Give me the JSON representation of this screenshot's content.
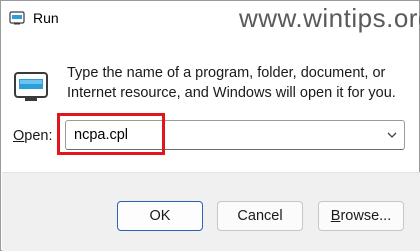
{
  "window": {
    "title": "Run",
    "icon": "run-icon"
  },
  "watermark": "www.wintips.org",
  "description": {
    "line1": "Type the name of a program, folder, document, or",
    "line2": "Internet resource, and Windows will open it for you."
  },
  "open": {
    "label_accel": "O",
    "label_rest": "pen:",
    "value": "ncpa.cpl",
    "highlight_color": "#e3141b"
  },
  "buttons": {
    "ok": "OK",
    "cancel": "Cancel",
    "browse_accel": "B",
    "browse_rest": "rowse..."
  },
  "colors": {
    "accent": "#2b63b7",
    "footer_bg": "#f0f0f0"
  }
}
